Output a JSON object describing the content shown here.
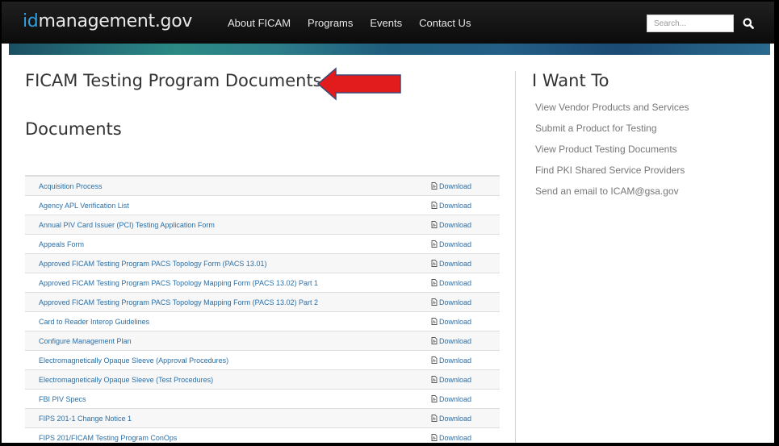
{
  "header": {
    "logo_id": "id",
    "logo_rest": "management.gov",
    "nav": [
      {
        "label": "About FICAM"
      },
      {
        "label": "Programs"
      },
      {
        "label": "Events"
      },
      {
        "label": "Contact Us"
      }
    ],
    "search": {
      "placeholder": "Search..."
    }
  },
  "main": {
    "page_title": "FICAM Testing Program Documents",
    "section_title": "Documents",
    "download_label": "Download",
    "documents": [
      "Acquisition Process",
      "Agency APL Verification List",
      "Annual PIV Card Issuer (PCI) Testing Application Form",
      "Appeals Form",
      "Approved FICAM Testing Program PACS Topology Form (PACS 13.01)",
      "Approved FICAM Testing Program PACS Topology Mapping Form (PACS 13.02) Part 1",
      "Approved FICAM Testing Program PACS Topology Mapping Form (PACS 13.02) Part 2",
      "Card to Reader Interop Guidelines",
      "Configure Management Plan",
      "Electromagnetically Opaque Sleeve (Approval Procedures)",
      "Electromagnetically Opaque Sleeve (Test Procedures)",
      "FBI PIV Specs",
      "FIPS 201-1 Change Notice 1",
      "FIPS 201/FICAM Testing Program ConOps"
    ]
  },
  "sidebar": {
    "title": "I Want To",
    "items": [
      "View Vendor Products and Services",
      "Submit a Product for Testing",
      "View Product Testing Documents",
      "Find PKI Shared Service Providers",
      "Send an email to ICAM@gsa.gov"
    ]
  },
  "colors": {
    "header_bg": "#111111",
    "logo_accent": "#2ea0e0",
    "link": "#2a6fa8",
    "arrow": "#e21c1c"
  }
}
